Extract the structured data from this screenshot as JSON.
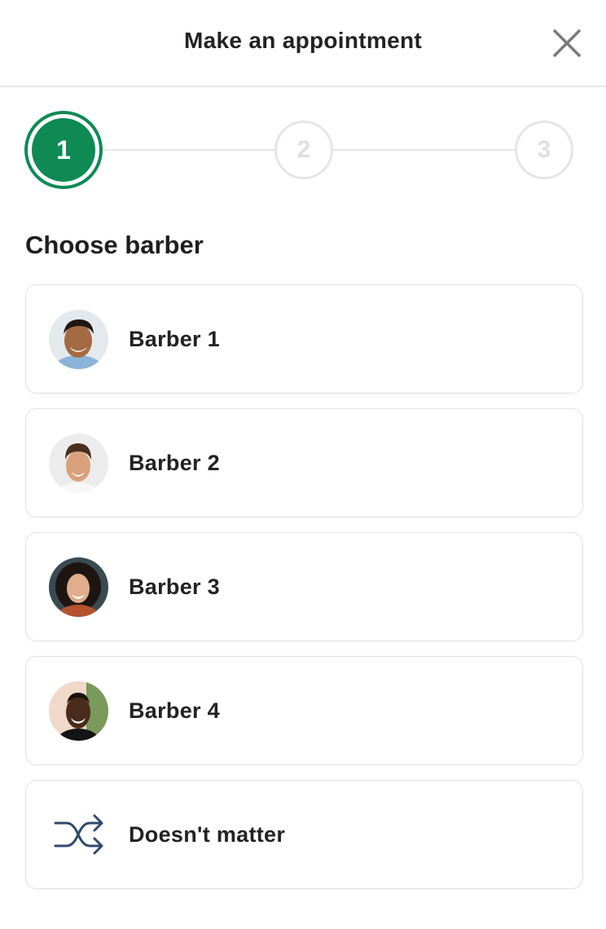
{
  "header": {
    "title": "Make an appointment",
    "close_icon": "close-icon"
  },
  "stepper": {
    "current": 1,
    "steps": [
      {
        "label": "1"
      },
      {
        "label": "2"
      },
      {
        "label": "3"
      }
    ],
    "active_color": "#0f8a55",
    "inactive_color": "#e6e6e6"
  },
  "section": {
    "title": "Choose barber"
  },
  "barbers": [
    {
      "name": "Barber 1",
      "avatar": "avatar-photo"
    },
    {
      "name": "Barber 2",
      "avatar": "avatar-photo"
    },
    {
      "name": "Barber 3",
      "avatar": "avatar-photo"
    },
    {
      "name": "Barber 4",
      "avatar": "avatar-photo"
    },
    {
      "name": "Doesn't matter",
      "icon": "shuffle-icon"
    }
  ],
  "colors": {
    "shuffle_icon": "#2f4a6b"
  }
}
